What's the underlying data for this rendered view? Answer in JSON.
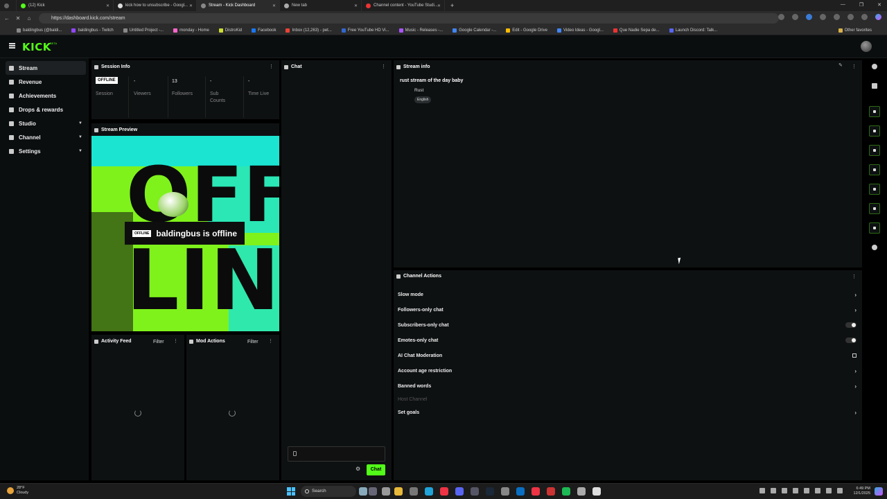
{
  "browser": {
    "tabs": [
      {
        "label": ""
      },
      {
        "label": "(12) Kick"
      },
      {
        "label": "kick how to unsubscribe - Googl..."
      },
      {
        "label": "Stream - Kick Dashboard"
      },
      {
        "label": "New tab"
      },
      {
        "label": "Channel content - YouTube Studi..."
      }
    ],
    "url": "https://dashboard.kick.com/stream",
    "bookmarks": [
      "baldingbus (@baldi...",
      "baldingbus - Twitch",
      "Untitled Project -...",
      "monday - Home",
      "DistroKid",
      "Facebook",
      "Inbox (12,263) - pet...",
      "Free YouTube HD Vi...",
      "Music - Releases -...",
      "Google Calendar -...",
      "Edit - Google Drive",
      "Video Ideas - Googl...",
      "Que Nadie Sepa de...",
      "Launch Discord: Talk..."
    ],
    "other_favorites": "Other favorites"
  },
  "kick": {
    "logo": "KICK",
    "beta": "BETA"
  },
  "sidebar": {
    "items": [
      {
        "label": "Stream",
        "active": true
      },
      {
        "label": "Revenue"
      },
      {
        "label": "Achievements"
      },
      {
        "label": "Drops & rewards"
      },
      {
        "label": "Studio",
        "chevron": true
      },
      {
        "label": "Channel",
        "chevron": true
      },
      {
        "label": "Settings",
        "chevron": true
      }
    ]
  },
  "session_info": {
    "title": "Session Info",
    "status": "OFFLINE",
    "session_label": "Session",
    "viewers_value": "-",
    "viewers_label": "Viewers",
    "followers_value": "13",
    "followers_label": "Followers",
    "sub_value": "-",
    "sub_label_1": "Sub",
    "sub_label_2": "Counts",
    "time_value": "-",
    "time_label": "Time Live"
  },
  "stream_preview": {
    "title": "Stream Preview",
    "badge": "OFFLINE",
    "message": "baldingbus is offline",
    "art_letters": [
      "OFF",
      "LIN"
    ]
  },
  "activity_feed": {
    "title": "Activity Feed",
    "filter": "Filter"
  },
  "mod_actions": {
    "title": "Mod Actions",
    "filter": "Filter"
  },
  "chat": {
    "title": "Chat",
    "send_label": "Chat",
    "input_placeholder": ""
  },
  "stream_info": {
    "title": "Stream info",
    "stream_title": "rust stream of the day baby",
    "category": "Rust",
    "tag": "English"
  },
  "channel_actions": {
    "title": "Channel Actions",
    "rows": [
      {
        "label": "Slow mode",
        "control": "arrow"
      },
      {
        "label": "Followers-only chat",
        "control": "arrow"
      },
      {
        "label": "Subscribers-only chat",
        "control": "toggle",
        "on": false
      },
      {
        "label": "Emotes-only chat",
        "control": "toggle",
        "on": false
      },
      {
        "label": "AI Chat Moderation",
        "control": "external"
      },
      {
        "label": "Account age restriction",
        "control": "arrow"
      },
      {
        "label": "Banned words",
        "control": "arrow"
      },
      {
        "label": "Host Channel",
        "control": "none",
        "disabled": true
      },
      {
        "label": "Set goals",
        "control": "arrow"
      }
    ]
  },
  "taskbar": {
    "temperature": "28°F",
    "weather": "Cloudy",
    "search": "Search",
    "time": "6:49 PM",
    "date": "12/1/2025"
  },
  "colors": {
    "accent": "#53fc18",
    "panel": "#0e1112",
    "background": "#000000"
  }
}
